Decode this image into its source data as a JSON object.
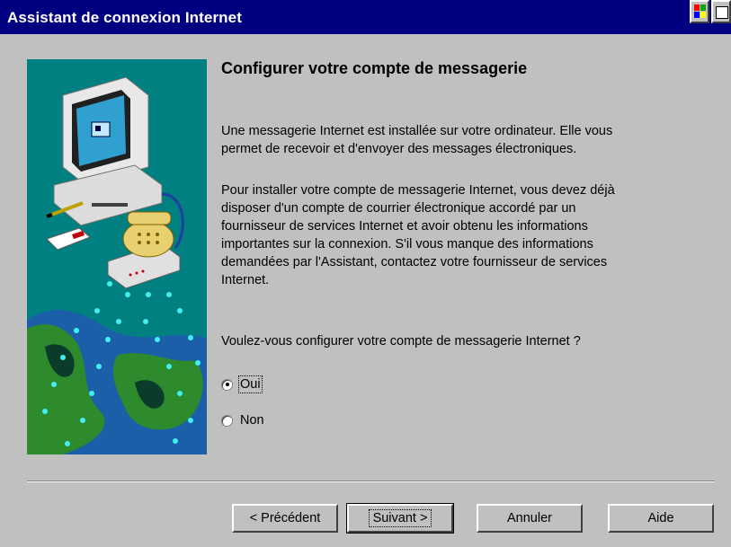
{
  "window": {
    "title": "Assistant de connexion Internet"
  },
  "content": {
    "heading": "Configurer votre compte de messagerie",
    "paragraph1": [
      "Une messagerie Internet est installée sur votre ordinateur. Elle vous",
      "permet de recevoir et d'envoyer des messages électroniques."
    ],
    "paragraph2": [
      "Pour installer votre compte de messagerie Internet, vous devez déjà",
      "disposer d'un compte de courrier électronique accordé par un",
      "fournisseur de services Internet et avoir obtenu les informations",
      "importantes sur la connexion. S'il vous manque des informations",
      "demandées par l'Assistant, contactez votre fournisseur de services",
      "Internet."
    ],
    "question": "Voulez-vous configurer votre compte de messagerie Internet ?",
    "options": [
      {
        "label": "Oui",
        "selected": true
      },
      {
        "label": "Non",
        "selected": false
      }
    ]
  },
  "buttons": {
    "previous": "< Précédent",
    "next": "Suivant >",
    "cancel": "Annuler",
    "help": "Aide"
  },
  "colors": {
    "title_bar": "#000080",
    "dialog_bg": "#c0c0c0",
    "illustration_bg": "#008080"
  },
  "icons": [
    "windows-flag-icon",
    "keyboard-layout-icon",
    "computer-phone-illustration"
  ]
}
